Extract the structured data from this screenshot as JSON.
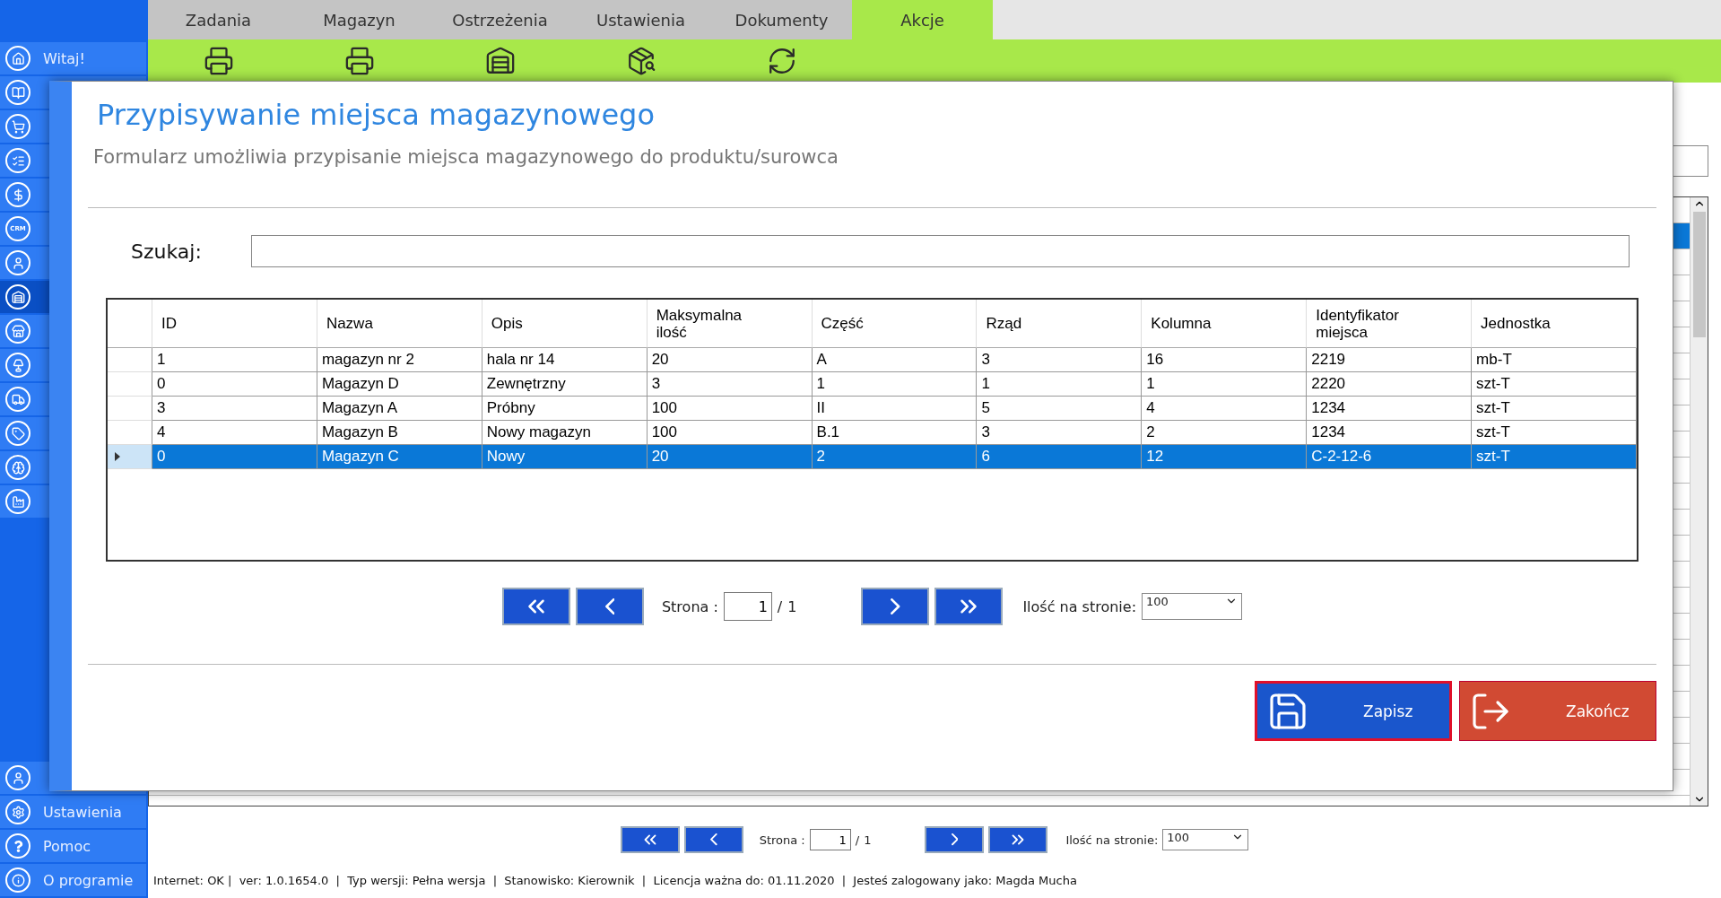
{
  "sidebar": {
    "top_items": [
      {
        "kind": "house",
        "label": "Witaj!",
        "selected": false
      },
      {
        "kind": "book",
        "selected": false
      },
      {
        "kind": "cart",
        "selected": false
      },
      {
        "kind": "list",
        "selected": false
      },
      {
        "kind": "dollar",
        "selected": false
      },
      {
        "kind": "badge",
        "badge": "CRM",
        "selected": false
      },
      {
        "kind": "user",
        "selected": false
      },
      {
        "kind": "warehouse",
        "selected": true
      },
      {
        "kind": "store",
        "selected": false
      },
      {
        "kind": "lamp",
        "selected": false
      },
      {
        "kind": "truck",
        "selected": false
      },
      {
        "kind": "tag",
        "selected": false
      },
      {
        "kind": "brain",
        "selected": false
      },
      {
        "kind": "factory",
        "selected": false
      }
    ],
    "bottom_items": [
      {
        "kind": "user",
        "selected": false
      },
      {
        "kind": "settings",
        "label": "Ustawienia",
        "selected": false
      },
      {
        "kind": "help",
        "label": "Pomoc",
        "selected": false
      },
      {
        "kind": "info",
        "label": "O programie",
        "selected": false
      }
    ]
  },
  "tabs": [
    {
      "label": "Zadania",
      "selected": false
    },
    {
      "label": "Magazyn",
      "selected": false
    },
    {
      "label": "Ostrzeżenia",
      "selected": false
    },
    {
      "label": "Ustawienia",
      "selected": false
    },
    {
      "label": "Dokumenty",
      "selected": false
    },
    {
      "label": "Akcje",
      "selected": true
    }
  ],
  "toolbar": [
    {
      "kind": "printer"
    },
    {
      "kind": "printer"
    },
    {
      "kind": "shelf"
    },
    {
      "kind": "shelf-search"
    },
    {
      "kind": "refresh"
    }
  ],
  "dialog": {
    "title": "Przypisywanie miejsca magazynowego",
    "description": "Formularz umożliwia przypisanie miejsca magazynowego do produktu/surowca",
    "search": {
      "label": "Szukaj:"
    },
    "table": {
      "columns": [
        "ID",
        "Nazwa",
        "Opis",
        "Maksymalna ilość",
        "Część",
        "Rząd",
        "Kolumna",
        "Identyfikator miejsca",
        "Jednostka"
      ],
      "rows": [
        {
          "cells": [
            "1",
            "magazyn nr 2",
            "hala nr 14",
            "20",
            "A",
            "3",
            "16",
            "2219",
            "mb-T"
          ],
          "selected": false
        },
        {
          "cells": [
            "0",
            "Magazyn D",
            "Zewnętrzny",
            "3",
            "1",
            "1",
            "1",
            "2220",
            "szt-T"
          ],
          "selected": false
        },
        {
          "cells": [
            "3",
            "Magazyn A",
            "Próbny",
            "100",
            "II",
            "5",
            "4",
            "1234",
            "szt-T"
          ],
          "selected": false
        },
        {
          "cells": [
            "4",
            "Magazyn B",
            "Nowy magazyn",
            "100",
            "B.1",
            "3",
            "2",
            "1234",
            "szt-T"
          ],
          "selected": false
        },
        {
          "cells": [
            "0",
            "Magazyn C",
            "Nowy",
            "20",
            "2",
            "6",
            "12",
            "C-2-12-6",
            "szt-T"
          ],
          "selected": true
        }
      ]
    },
    "pager": {
      "page_label": "Strona :",
      "page": "1",
      "separator": "/",
      "total": "1",
      "per_page_label": "Ilość na stronie:",
      "per_page": "100"
    },
    "save_button": "Zapisz",
    "close_button": "Zakończ"
  },
  "pager": {
    "page_label": "Strona :",
    "page": "1",
    "separator": "/",
    "total": "1",
    "per_page_label": "Ilość na stronie:",
    "per_page": "100"
  },
  "status_bar": "Internet: OK |  ver: 1.0.1654.0  |  Typ wersji: Pełna wersja  |  Stanowisko: Kierownik  |  Licencja ważna do: 01.11.2020  |  Jesteś zalogowany jako: Magda Mucha"
}
